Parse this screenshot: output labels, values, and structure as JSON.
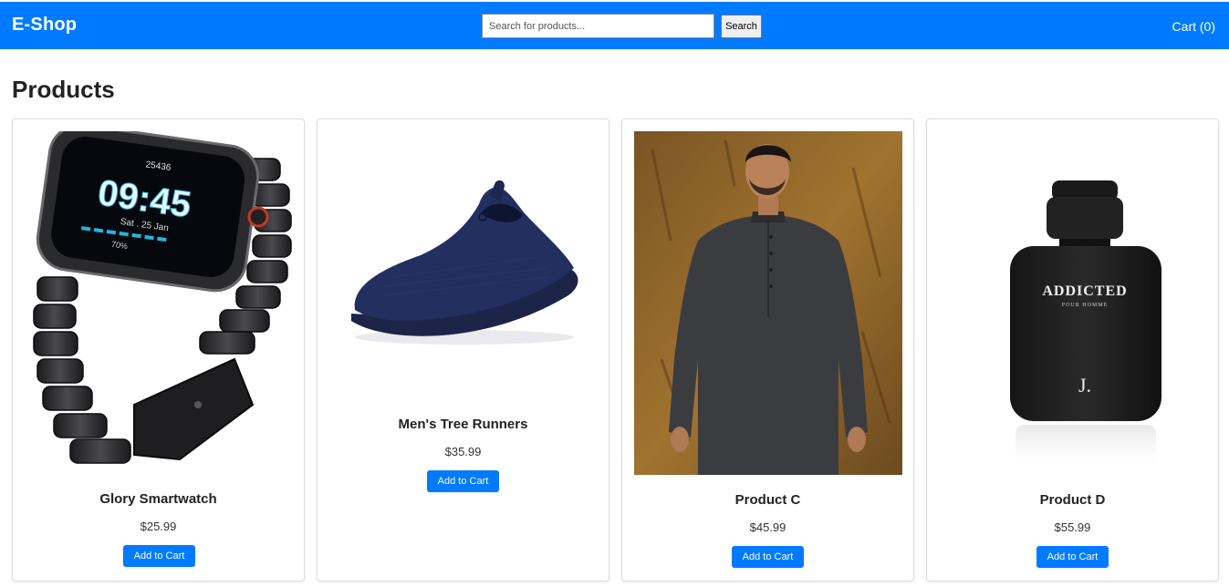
{
  "header": {
    "brand": "E-Shop",
    "search_placeholder": "Search for products...",
    "search_value": "",
    "search_button": "Search",
    "cart_label": "Cart (0)"
  },
  "main": {
    "title": "Products",
    "products": [
      {
        "name": "Glory Smartwatch",
        "price": "$25.99",
        "button": "Add to Cart",
        "image": "smartwatch-image"
      },
      {
        "name": "Men's Tree Runners",
        "price": "$35.99",
        "button": "Add to Cart",
        "image": "shoe-image"
      },
      {
        "name": "Product C",
        "price": "$45.99",
        "button": "Add to Cart",
        "image": "kurta-model-image"
      },
      {
        "name": "Product D",
        "price": "$55.99",
        "button": "Add to Cart",
        "image": "perfume-bottle-image",
        "image_text": {
          "brand": "ADDICTED",
          "sub": "POUR HOMME",
          "mark": "J."
        }
      }
    ],
    "watch_face": {
      "steps": "25436",
      "time": "09:45",
      "date": "Sat . 25 Jan",
      "battery": "70%"
    }
  },
  "colors": {
    "accent": "#007bff",
    "header_text": "#ffffff"
  }
}
